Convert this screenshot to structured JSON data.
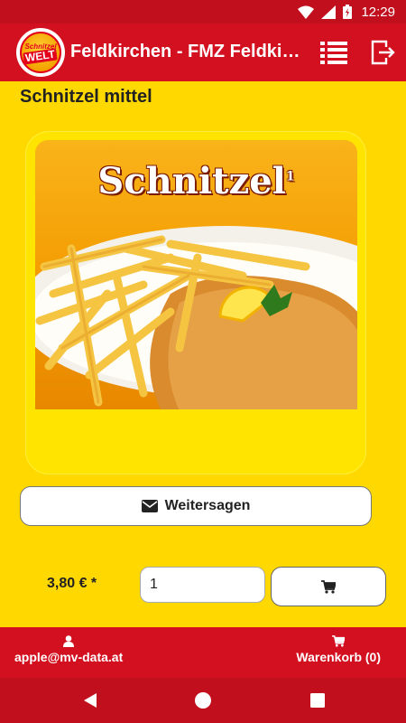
{
  "status": {
    "time": "12:29"
  },
  "appbar": {
    "logo_top": "Schnitzel",
    "logo_bottom": "WELT",
    "title": "Feldkirchen - FMZ Feldkirchen",
    "icons": [
      "list-icon",
      "logout-icon"
    ]
  },
  "product": {
    "title": "Schnitzel mittel",
    "image_caption": "Schnitzel",
    "image_caption_note": "1",
    "share_label": "Weitersagen",
    "price": "3,80 € *",
    "quantity": "1"
  },
  "bottombar": {
    "user_email": "apple@mv-data.at",
    "cart_label": "Warenkorb (0)"
  },
  "colors": {
    "primary_red": "#d3101f",
    "background_yellow": "#ffd800"
  }
}
